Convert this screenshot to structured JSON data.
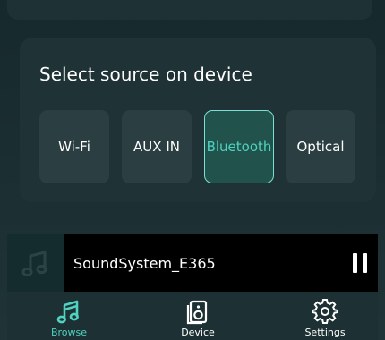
{
  "source_panel": {
    "title": "Select source on device",
    "sources": [
      {
        "label": "Wi-Fi",
        "selected": false
      },
      {
        "label": "AUX IN",
        "selected": false
      },
      {
        "label": "Bluetooth",
        "selected": true
      },
      {
        "label": "Optical",
        "selected": false
      }
    ]
  },
  "player": {
    "track": "SoundSystem_E365",
    "album_icon": "music-note-icon",
    "control_icon": "pause-icon"
  },
  "nav": {
    "items": [
      {
        "label": "Browse",
        "icon": "music-note-icon",
        "active": true
      },
      {
        "label": "Device",
        "icon": "speaker-icon",
        "active": false
      },
      {
        "label": "Settings",
        "icon": "gear-icon",
        "active": false
      }
    ]
  },
  "colors": {
    "accent": "#4fd2c0",
    "background": "#1a2d31",
    "card": "#1f3336",
    "button": "#2b3e41",
    "player_bg": "#000000"
  }
}
